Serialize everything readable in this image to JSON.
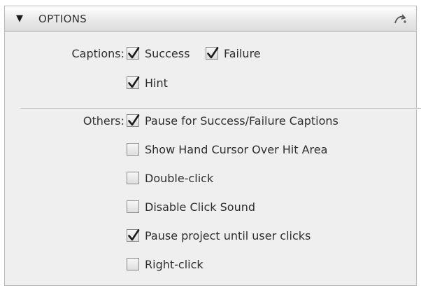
{
  "panel": {
    "title": "OPTIONS",
    "collapse_icon": "triangle-down-icon",
    "action_icon": "reset-arrow-icon"
  },
  "captions": {
    "label": "Captions:",
    "items": [
      {
        "label": "Success",
        "checked": true
      },
      {
        "label": "Failure",
        "checked": true
      },
      {
        "label": "Hint",
        "checked": true
      }
    ]
  },
  "others": {
    "label": "Others:",
    "items": [
      {
        "label": "Pause for Success/Failure Captions",
        "checked": true
      },
      {
        "label": "Show Hand Cursor Over Hit Area",
        "checked": false
      },
      {
        "label": "Double-click",
        "checked": false
      },
      {
        "label": "Disable Click Sound",
        "checked": false
      },
      {
        "label": "Pause project until user clicks",
        "checked": true
      },
      {
        "label": "Right-click",
        "checked": false
      }
    ]
  },
  "colors": {
    "panel_background": "#efefef",
    "checkmark": "#1c1c1c"
  }
}
